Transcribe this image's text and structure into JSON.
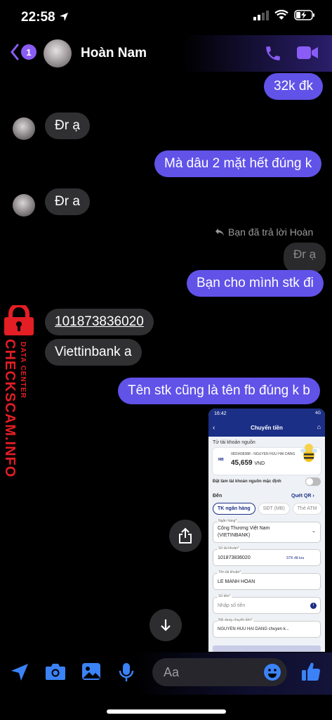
{
  "status_bar": {
    "time": "22:58"
  },
  "header": {
    "back_badge": "1",
    "contact_name": "Hoàn Nam"
  },
  "messages": {
    "m1": "32k đk",
    "m2": "Đr ạ",
    "m3": "Mà dâu 2 mặt hết đúng k",
    "m4": "Đr a",
    "reply_note": "Bạn đã trả lời Hoàn",
    "quoted": "Đr ạ",
    "m5": "Bạn cho mình stk đi",
    "m6": "101873836020",
    "m7": "Viettinbank a",
    "m8": "Tên stk cũng là tên fb đúng k b"
  },
  "watermark": {
    "main": "CHECKSCAM.INFO",
    "sub": "DATA CENTER"
  },
  "shared_screenshot": {
    "time": "16:42",
    "status": "4G",
    "title": "Chuyển tiền",
    "from_label": "Từ tài khoản nguồn",
    "bank_logo": "MB",
    "account": "0833438388 - NGUYEN HUU HAI DANG",
    "balance": "45,659",
    "currency": "VND",
    "default_label": "Đặt làm tài khoản nguồn mặc định",
    "to_label": "Đến",
    "scan_qr": "Quét QR",
    "tabs": [
      "TK ngân hàng",
      "SĐT (MB)",
      "Thẻ ATM"
    ],
    "bank_field_label": "Ngân hàng*",
    "bank_value_line1": "Công Thương Việt Nam",
    "bank_value_line2": "(VIETINBANK)",
    "account_field_label": "Số tài khoản*",
    "account_value": "101873836020",
    "saved_label": "STK đã lưu",
    "name_field_label": "Tên tài khoản*",
    "name_value": "LE MANH HOAN",
    "amount_field_label": "Số tiền*",
    "amount_placeholder": "Nhập số tiền",
    "note_field_label": "Nội dung chuyển tiền*",
    "note_value": "NGUYEN HUU HAI DANG chuyen k..."
  },
  "composer": {
    "placeholder": "Aa"
  },
  "colors": {
    "outgoing": "#6152e8",
    "incoming": "#303033",
    "accent": "#8a5cf6",
    "messenger_blue": "#3b82f6"
  }
}
